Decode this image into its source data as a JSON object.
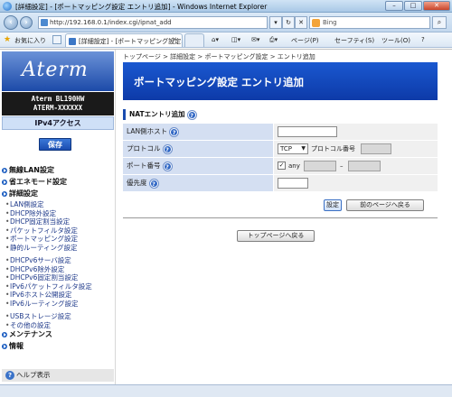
{
  "window": {
    "title": "[詳細設定] - [ポートマッピング設定 エントリ追加] - Windows Internet Explorer"
  },
  "address": {
    "url": "http://192.168.0.1/index.cgi/ipnat_add"
  },
  "search": {
    "placeholder": "Bing"
  },
  "favorites": {
    "label": "お気に入り"
  },
  "tabs": [
    {
      "label": "[詳細設定] - [ポートマッピング設定..."
    },
    {
      "label": ""
    }
  ],
  "commands": {
    "page": "ページ(P)",
    "safety": "セーフティ(S)",
    "tools": "ツール(O)",
    "help": "?"
  },
  "sidebar": {
    "logo": "Aterm",
    "model_line1": "Aterm BL190HW",
    "model_line2": "ATERM-XXXXXX",
    "mode": "IPv4アクセス",
    "save": "保存",
    "menu": {
      "wireless": "無線LAN設定",
      "eco": "省エネモード設定",
      "advanced": "詳細設定",
      "sub1": [
        "LAN側設定",
        "DHCP除外設定",
        "DHCP固定割当設定",
        "パケットフィルタ設定",
        "ポートマッピング設定",
        "静的ルーティング設定"
      ],
      "sub2": [
        "DHCPv6サーバ設定",
        "DHCPv6除外設定",
        "DHCPv6固定割当設定",
        "IPv6パケットフィルタ設定",
        "IPv6ホスト公開設定",
        "IPv6ルーティング設定"
      ],
      "sub3": [
        "USBストレージ設定",
        "その他の設定"
      ],
      "maintenance": "メンテナンス",
      "info": "情報"
    },
    "help": "ヘルプ表示"
  },
  "main": {
    "breadcrumb": "トップページ > 詳細設定 > ポートマッピング設定 > エントリ追加",
    "title": "ポートマッピング設定 エントリ追加",
    "section": "NATエントリ追加",
    "fields": {
      "lan_host": "LAN側ホスト",
      "protocol": "プロトコル",
      "protocol_value": "TCP",
      "protocol_number": "プロトコル番号",
      "port": "ポート番号",
      "any": "any",
      "dash": "–",
      "priority": "優先度"
    },
    "buttons": {
      "set": "設定",
      "back": "前のページへ戻る",
      "top": "トップページへ戻る"
    }
  }
}
